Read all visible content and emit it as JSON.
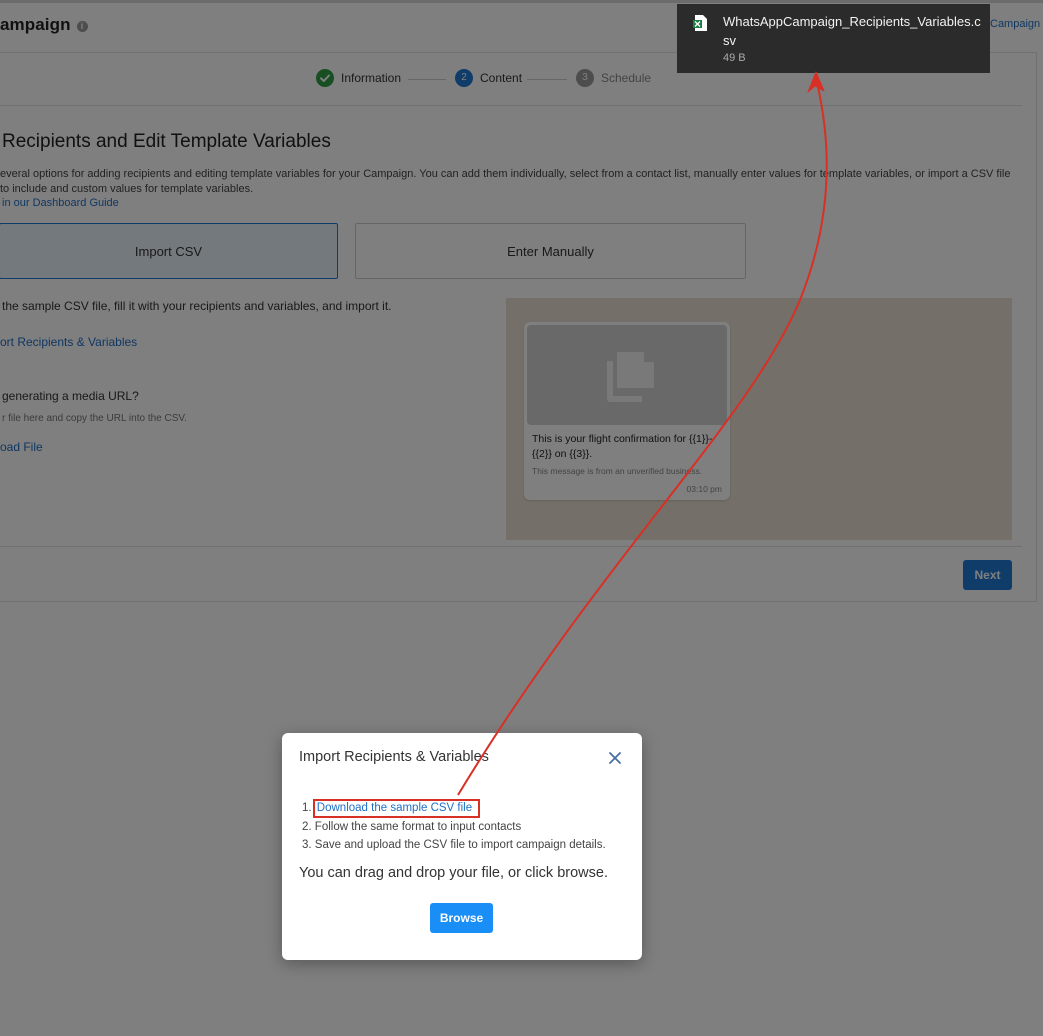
{
  "header": {
    "page_title": "ampaign",
    "info_icon": "i",
    "top_right_link": "Campaign"
  },
  "stepper": {
    "steps": [
      {
        "label": "Information",
        "state": "complete",
        "number": ""
      },
      {
        "label": "Content",
        "state": "active",
        "number": "2"
      },
      {
        "label": "Schedule",
        "state": "pending",
        "number": "3"
      }
    ]
  },
  "content": {
    "title": "Recipients and Edit Template Variables",
    "description": "everal options for adding recipients and editing template variables for your Campaign. You can add them individually, select from a contact list, manually enter values for template variables, or import a CSV file to include and custom values for template variables.",
    "guide_link": "in our Dashboard Guide",
    "options": [
      {
        "label": "Import CSV",
        "selected": true
      },
      {
        "label": "Enter Manually",
        "selected": false
      }
    ],
    "sample_instructions": "the sample CSV file, fill it with your recipients and variables, and import it.",
    "import_link": "ort Recipients & Variables",
    "media_question": "generating a media URL?",
    "media_hint": "r file here and copy the URL into the CSV.",
    "upload_link": "oad File"
  },
  "preview": {
    "message": "This is your flight confirmation for {{1}}-{{2}} on {{3}}.",
    "note": "This message is from an unverified business.",
    "time": "03:10 pm",
    "media_icon": "document-copy-icon"
  },
  "footer": {
    "next_label": "Next"
  },
  "modal": {
    "title": "Import Recipients & Variables",
    "steps": [
      {
        "num": "1.",
        "text": "Download the sample CSV file",
        "is_link": true
      },
      {
        "num": "2.",
        "text": "Follow the same format to input contacts",
        "is_link": false
      },
      {
        "num": "3.",
        "text": "Save and upload the CSV file to import campaign details.",
        "is_link": false
      }
    ],
    "drag_text": "You can drag and drop your file, or click browse.",
    "browse_label": "Browse"
  },
  "download": {
    "filename": "WhatsAppCampaign_Recipients_Variables.csv",
    "size": "49 B",
    "file_icon": "excel-file-icon"
  },
  "colors": {
    "accent": "#1f78d1",
    "browse": "#1a8ef7",
    "complete": "#2e9e44",
    "annotation": "#d93025",
    "download_bg": "#2b2b2b"
  }
}
